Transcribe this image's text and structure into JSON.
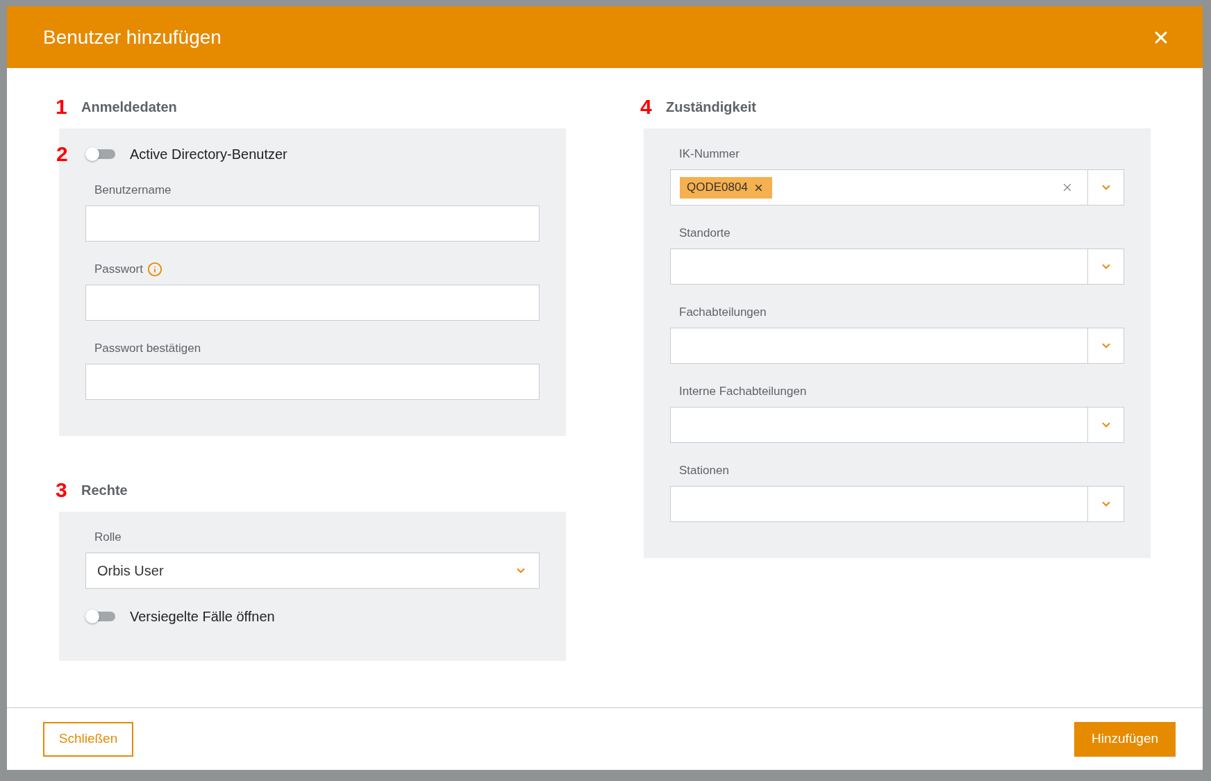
{
  "dialog": {
    "title": "Benutzer hinzufügen",
    "columns": [
      {
        "sections": [
          {
            "marker": "1",
            "heading": "Anmeldedaten",
            "fields": [
              {
                "kind": "toggle",
                "marker": "2",
                "label": "Active Directory-Benutzer",
                "on": false
              },
              {
                "kind": "input",
                "label": "Benutzername"
              },
              {
                "kind": "input",
                "label": "Passwort",
                "info": true
              },
              {
                "kind": "input",
                "label": "Passwort bestätigen"
              }
            ]
          },
          {
            "marker": "3",
            "heading": "Rechte",
            "fields": [
              {
                "kind": "select",
                "label": "Rolle",
                "value": "Orbis User"
              },
              {
                "kind": "toggle",
                "label": "Versiegelte Fälle öffnen",
                "on": false
              }
            ]
          }
        ]
      },
      {
        "sections": [
          {
            "marker": "4",
            "heading": "Zuständigkeit",
            "fields": [
              {
                "kind": "multiselect",
                "label": "IK-Nummer",
                "tags": [
                  "QODE0804"
                ]
              },
              {
                "kind": "multiselect",
                "label": "Standorte"
              },
              {
                "kind": "multiselect",
                "label": "Fachabteilungen"
              },
              {
                "kind": "multiselect",
                "label": "Interne Fachabteilungen"
              },
              {
                "kind": "multiselect",
                "label": "Stationen"
              }
            ]
          }
        ]
      }
    ],
    "buttons": [
      {
        "kind": "secondary",
        "label": "Schließen"
      },
      {
        "kind": "primary",
        "label": "Hinzufügen"
      }
    ]
  }
}
